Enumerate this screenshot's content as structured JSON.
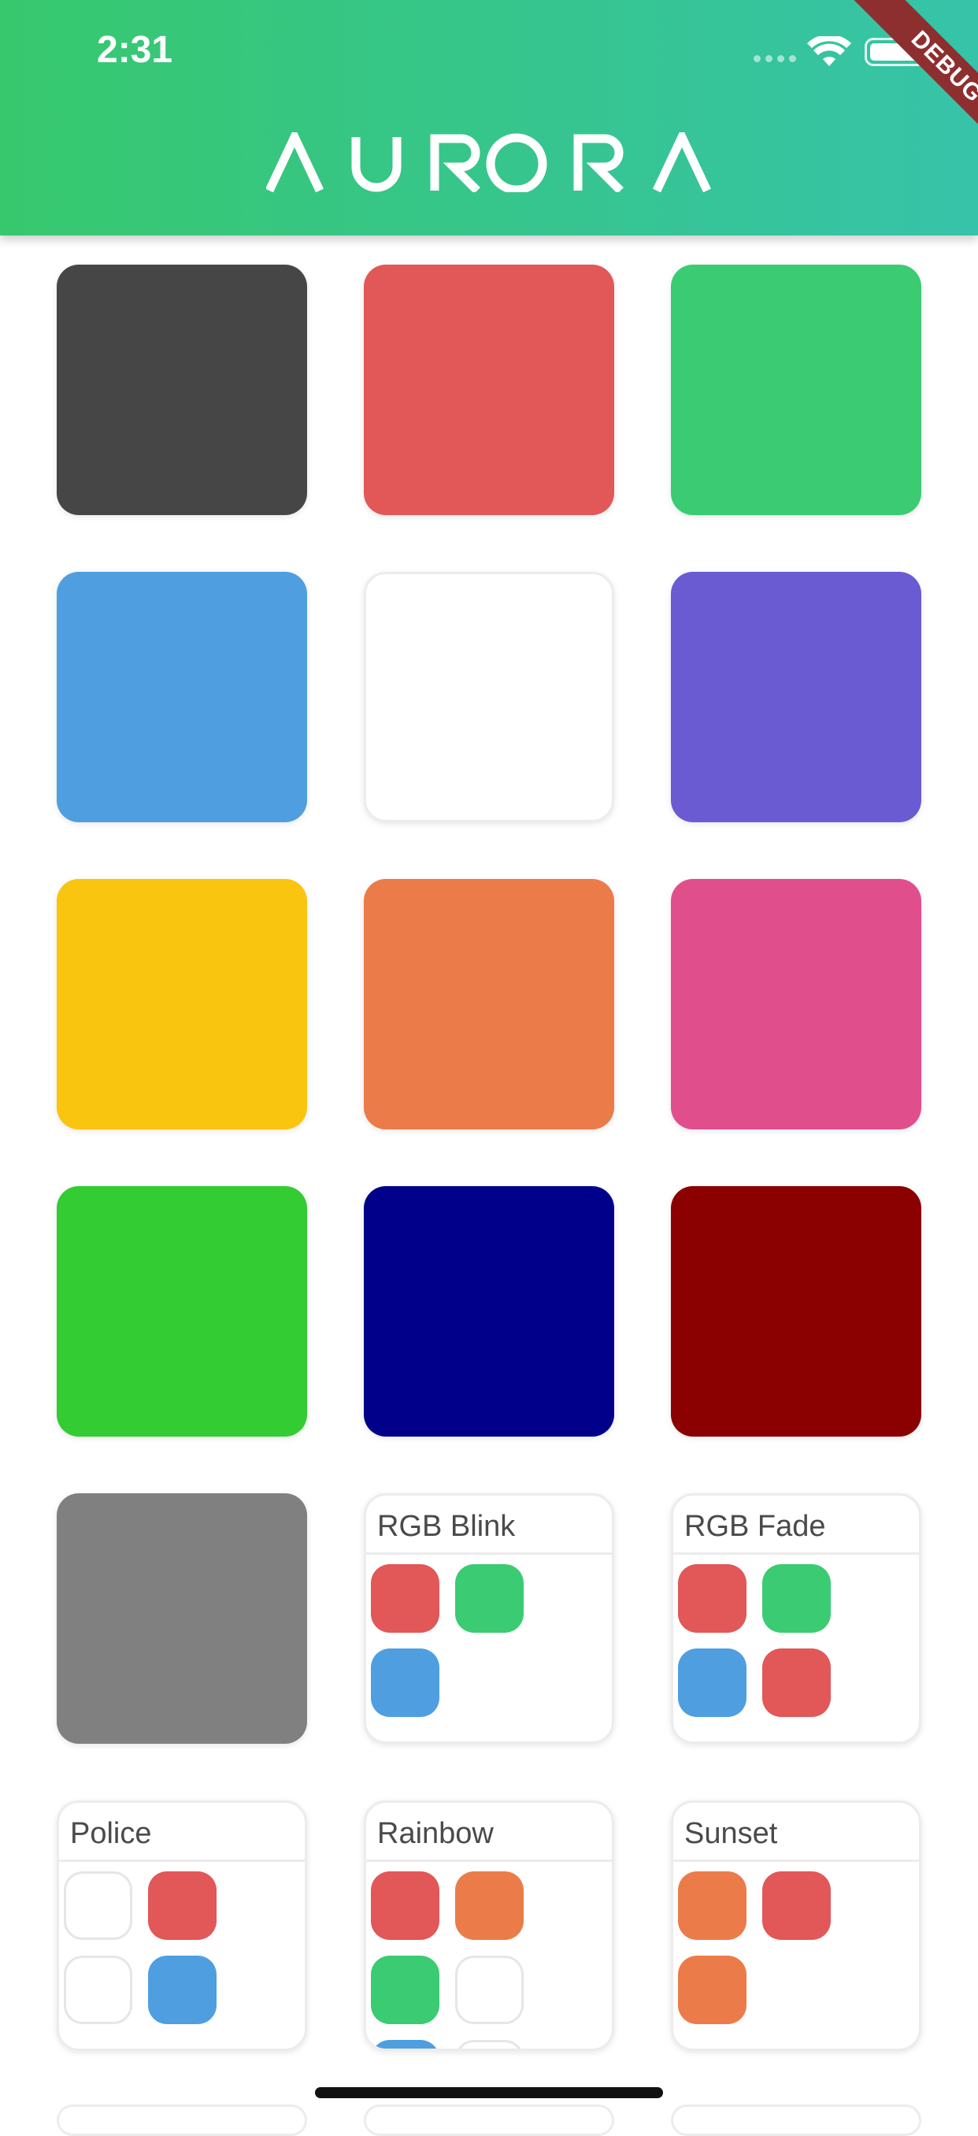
{
  "status_bar": {
    "time": "2:31"
  },
  "header": {
    "logo_text": "AURORA",
    "gradient_start": "#37c86e",
    "gradient_end": "#36c3a9"
  },
  "debug_banner": "DEBUG",
  "colors": [
    {
      "name": "dark-gray",
      "hex": "#464646"
    },
    {
      "name": "red",
      "hex": "#e25757"
    },
    {
      "name": "green",
      "hex": "#3bcb72"
    },
    {
      "name": "blue",
      "hex": "#4f9fe0"
    },
    {
      "name": "white",
      "hex": "#ffffff"
    },
    {
      "name": "purple",
      "hex": "#6a5bd3"
    },
    {
      "name": "yellow",
      "hex": "#f9c50f"
    },
    {
      "name": "orange",
      "hex": "#eb7c4a"
    },
    {
      "name": "pink",
      "hex": "#e04f8c"
    },
    {
      "name": "lime",
      "hex": "#33cc33"
    },
    {
      "name": "navy",
      "hex": "#00008b"
    },
    {
      "name": "dark-red",
      "hex": "#8b0000"
    },
    {
      "name": "gray",
      "hex": "#808080"
    }
  ],
  "presets": [
    {
      "label": "RGB Blink",
      "swatches": [
        "#e25757",
        "#3bcb72",
        "#4f9fe0"
      ]
    },
    {
      "label": "RGB Fade",
      "swatches": [
        "#e25757",
        "#3bcb72",
        "#4f9fe0",
        "#e25757"
      ]
    },
    {
      "label": "Police",
      "swatches": [
        "#ffffff",
        "#e25757",
        "#ffffff",
        "#4f9fe0"
      ]
    },
    {
      "label": "Rainbow",
      "swatches": [
        "#e25757",
        "#eb7c4a",
        "#3bcb72",
        "#ffffff",
        "#4f9fe0",
        "#ffffff"
      ]
    },
    {
      "label": "Sunset",
      "swatches": [
        "#eb7c4a",
        "#e25757",
        "#eb7c4a"
      ]
    }
  ]
}
